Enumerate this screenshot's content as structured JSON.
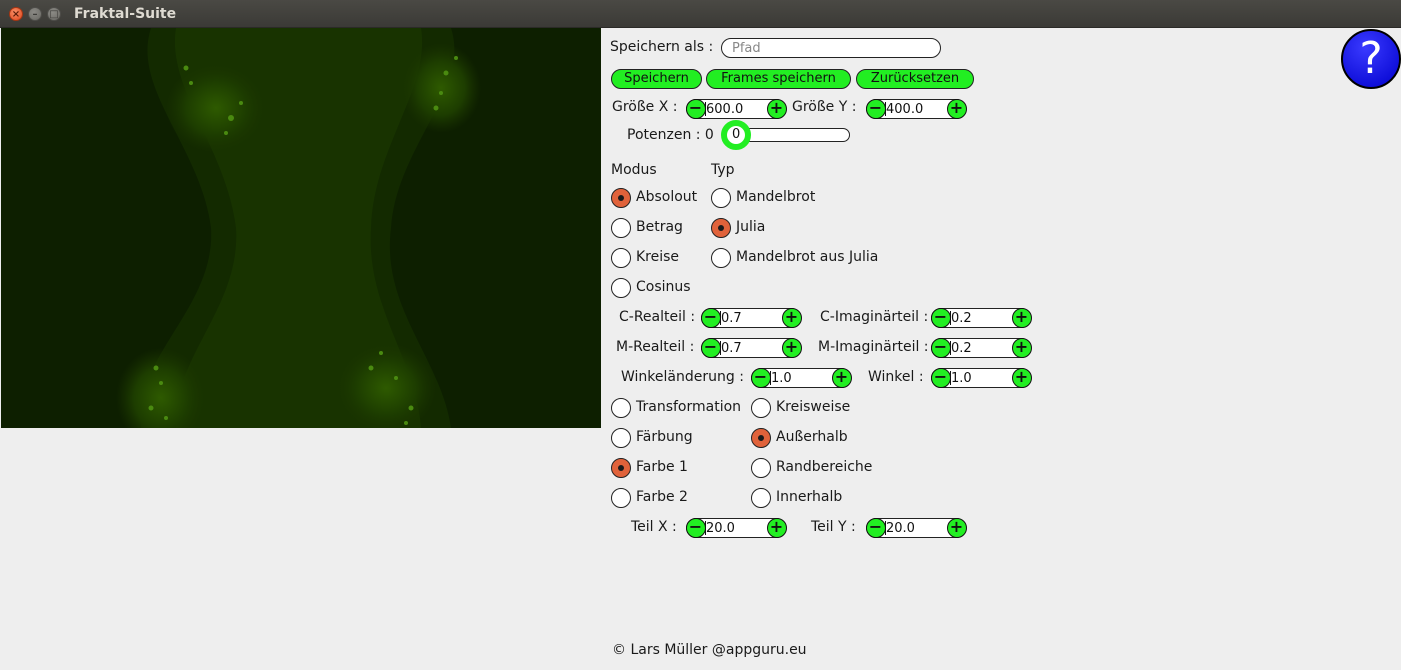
{
  "window": {
    "title": "Fraktal-Suite"
  },
  "save": {
    "label": "Speichern als :",
    "placeholder": "Pfad"
  },
  "buttons": {
    "save": "Speichern",
    "save_frames": "Frames speichern",
    "reset": "Zurücksetzen"
  },
  "size": {
    "x_label": "Größe X :",
    "x_value": "600.0",
    "y_label": "Größe Y :",
    "y_value": "400.0"
  },
  "powers": {
    "label": "Potenzen : 0",
    "value": "0"
  },
  "mode": {
    "header": "Modus",
    "options": [
      "Absolout",
      "Betrag",
      "Kreise",
      "Cosinus"
    ],
    "selected": "Absolout"
  },
  "type": {
    "header": "Typ",
    "options": [
      "Mandelbrot",
      "Julia",
      "Mandelbrot aus Julia"
    ],
    "selected": "Julia"
  },
  "params": {
    "c_real_label": "C-Realteil :",
    "c_real_value": "0.7",
    "c_imag_label": "C-Imaginärteil :",
    "c_imag_value": "0.2",
    "m_real_label": "M-Realteil :",
    "m_real_value": "0.7",
    "m_imag_label": "M-Imaginärteil :",
    "m_imag_value": "0.2",
    "angle_change_label": "Winkeländerung :",
    "angle_change_value": "1.0",
    "angle_label": "Winkel :",
    "angle_value": "1.0"
  },
  "left_options": [
    "Transformation",
    "Färbung",
    "Farbe 1",
    "Farbe 2"
  ],
  "right_options": [
    "Kreisweise",
    "Außerhalb",
    "Randbereiche",
    "Innerhalb"
  ],
  "parts": {
    "x_label": "Teil X :",
    "x_value": "20.0",
    "y_label": "Teil Y :",
    "y_value": "20.0"
  },
  "footer": "© Lars Müller @appguru.eu",
  "help": "?",
  "colors": {
    "accent_green": "#22ee22",
    "radio_selected": "#e0623a",
    "help_blue": "#0000cc"
  },
  "icons": {
    "close": "close-icon",
    "minimize": "minimize-icon",
    "maximize": "maximize-icon",
    "help": "question-mark-icon"
  }
}
